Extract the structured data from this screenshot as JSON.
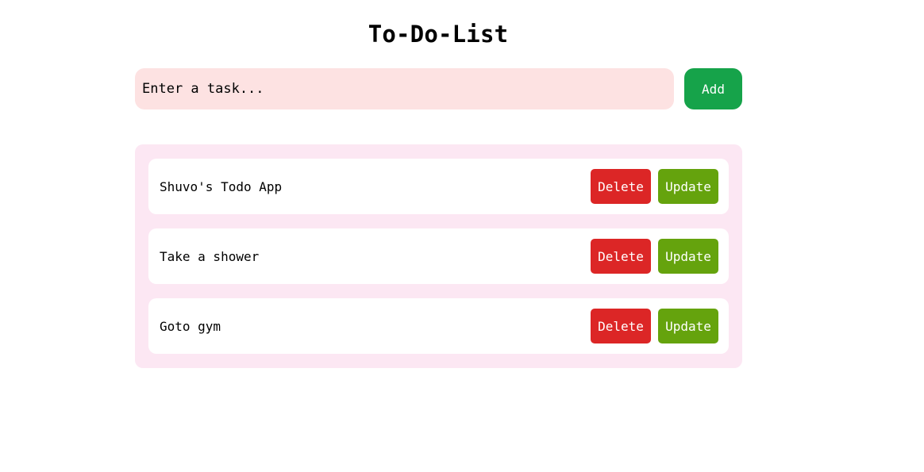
{
  "app": {
    "title": "To-Do-List"
  },
  "input": {
    "placeholder": "Enter a task...",
    "value": ""
  },
  "add_button": {
    "label": "Add"
  },
  "tasks": [
    {
      "text": "Shuvo's Todo App",
      "delete_label": "Delete",
      "update_label": "Update"
    },
    {
      "text": "Take a shower",
      "delete_label": "Delete",
      "update_label": "Update"
    },
    {
      "text": "Goto gym",
      "delete_label": "Delete",
      "update_label": "Update"
    }
  ],
  "colors": {
    "input_background": "#fde2e2",
    "add_button": "#16a34a",
    "list_background": "#fce7f3",
    "delete_button": "#dc2626",
    "update_button": "#65a30d"
  }
}
